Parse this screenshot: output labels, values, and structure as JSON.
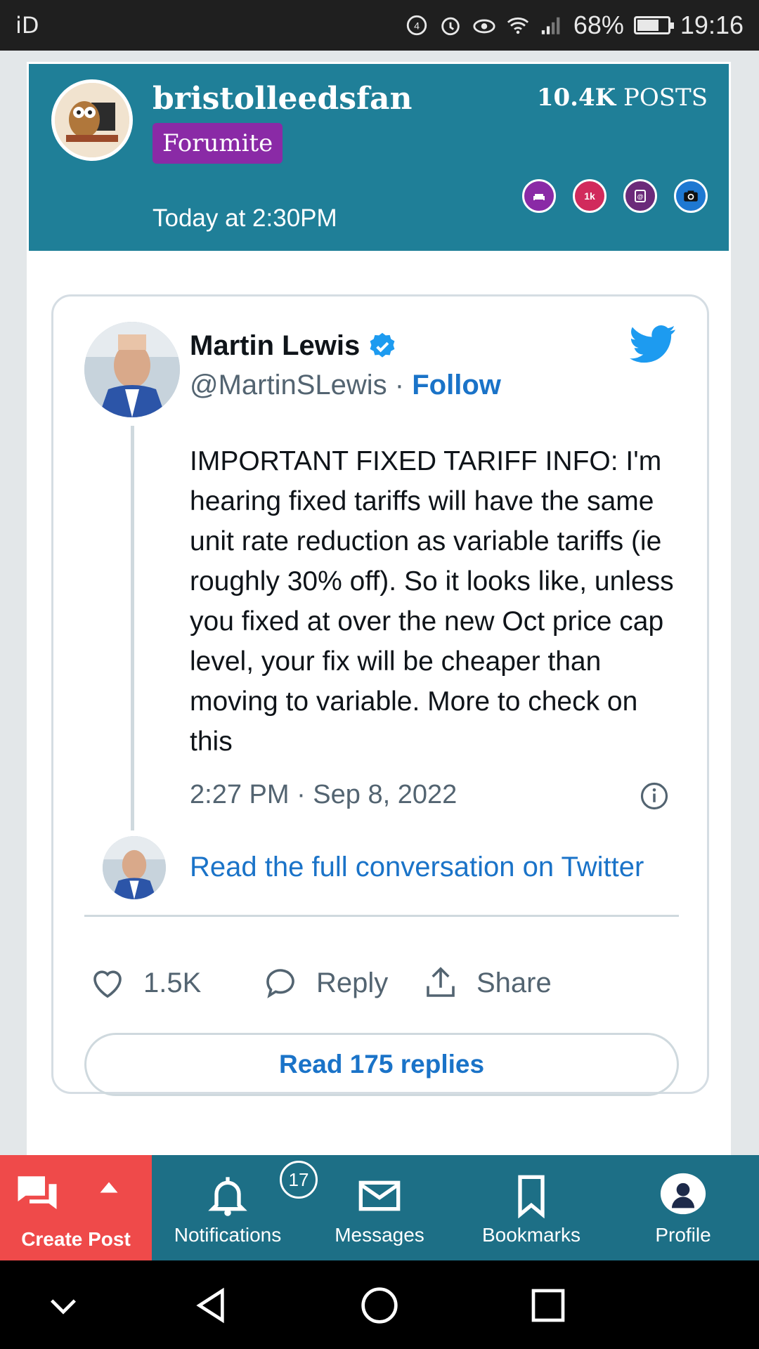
{
  "status_bar": {
    "carrier": "iD",
    "battery": "68%",
    "battery_level": 0.68,
    "time": "19:16"
  },
  "post": {
    "username": "bristolleedsfan",
    "rank": "Forumite",
    "posts_count": "10.4K",
    "posts_label": "POSTS",
    "time": "Today at 2:30PM",
    "trophies": [
      {
        "icon": "armchair-icon",
        "color": "#8a2aa6"
      },
      {
        "icon": "1k-badge-icon",
        "label": "1k",
        "color": "#d12a5c"
      },
      {
        "icon": "address-book-icon",
        "color": "#6b2a7a"
      },
      {
        "icon": "camera-icon",
        "color": "#1e78d2"
      }
    ]
  },
  "tweet": {
    "author": "Martin Lewis",
    "handle": "@MartinSLewis",
    "follow_label": "Follow",
    "text": "IMPORTANT FIXED TARIFF INFO: I'm hearing fixed tariffs will have the same unit rate reduction as variable tariffs (ie roughly 30% off). So it looks like, unless you fixed at over the new Oct price cap level, your fix will be cheaper than moving to variable. More to check on this",
    "timestamp": "2:27 PM · Sep 8, 2022",
    "read_conversation": "Read the full conversation on Twitter",
    "likes": "1.5K",
    "reply_label": "Reply",
    "share_label": "Share",
    "read_replies": "Read 175 replies",
    "brand_color": "#1d9bf0",
    "link_color": "#1a73c8"
  },
  "bottom_nav": {
    "create_post": "Create Post",
    "notifications": "Notifications",
    "notifications_count": "17",
    "messages": "Messages",
    "bookmarks": "Bookmarks",
    "profile": "Profile"
  }
}
